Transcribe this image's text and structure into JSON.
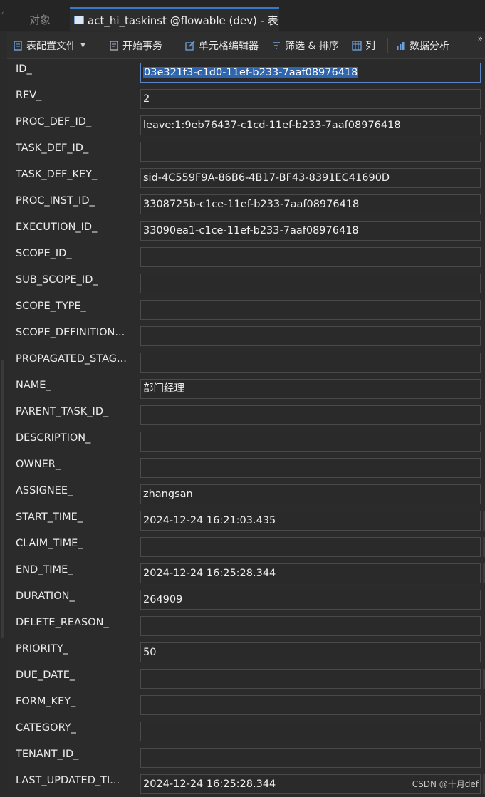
{
  "tabs": [
    {
      "label": "对象",
      "active": false
    },
    {
      "label": "act_hi_taskinst @flowable (dev) - 表",
      "active": true
    }
  ],
  "toolbar": {
    "table_config": "表配置文件",
    "begin_transaction": "开始事务",
    "cell_editor": "单元格编辑器",
    "filter_sort": "筛选 & 排序",
    "columns": "列",
    "data_analysis": "数据分析",
    "more": "»"
  },
  "fields": [
    {
      "label": "ID_",
      "value": "03e321f3-c1d0-11ef-b233-7aaf08976418",
      "selected": true
    },
    {
      "label": "REV_",
      "value": "2"
    },
    {
      "label": "PROC_DEF_ID_",
      "value": "leave:1:9eb76437-c1cd-11ef-b233-7aaf08976418"
    },
    {
      "label": "TASK_DEF_ID_",
      "value": ""
    },
    {
      "label": "TASK_DEF_KEY_",
      "value": "sid-4C559F9A-86B6-4B17-BF43-8391EC41690D"
    },
    {
      "label": "PROC_INST_ID_",
      "value": "3308725b-c1ce-11ef-b233-7aaf08976418"
    },
    {
      "label": "EXECUTION_ID_",
      "value": "33090ea1-c1ce-11ef-b233-7aaf08976418"
    },
    {
      "label": "SCOPE_ID_",
      "value": ""
    },
    {
      "label": "SUB_SCOPE_ID_",
      "value": ""
    },
    {
      "label": "SCOPE_TYPE_",
      "value": ""
    },
    {
      "label": "SCOPE_DEFINITION...",
      "value": ""
    },
    {
      "label": "PROPAGATED_STAG...",
      "value": ""
    },
    {
      "label": "NAME_",
      "value": "部门经理"
    },
    {
      "label": "PARENT_TASK_ID_",
      "value": ""
    },
    {
      "label": "DESCRIPTION_",
      "value": ""
    },
    {
      "label": "OWNER_",
      "value": ""
    },
    {
      "label": "ASSIGNEE_",
      "value": "zhangsan"
    },
    {
      "label": "START_TIME_",
      "value": "2024-12-24 16:21:03.435",
      "edge": true
    },
    {
      "label": "CLAIM_TIME_",
      "value": "",
      "edge": true
    },
    {
      "label": "END_TIME_",
      "value": "2024-12-24 16:25:28.344",
      "edge": true
    },
    {
      "label": "DURATION_",
      "value": "264909"
    },
    {
      "label": "DELETE_REASON_",
      "value": ""
    },
    {
      "label": "PRIORITY_",
      "value": "50"
    },
    {
      "label": "DUE_DATE_",
      "value": "",
      "edge": true
    },
    {
      "label": "FORM_KEY_",
      "value": ""
    },
    {
      "label": "CATEGORY_",
      "value": ""
    },
    {
      "label": "TENANT_ID_",
      "value": ""
    },
    {
      "label": "LAST_UPDATED_TI...",
      "value": "2024-12-24 16:25:28.344",
      "edge": true
    }
  ],
  "watermark": "CSDN @十月def"
}
